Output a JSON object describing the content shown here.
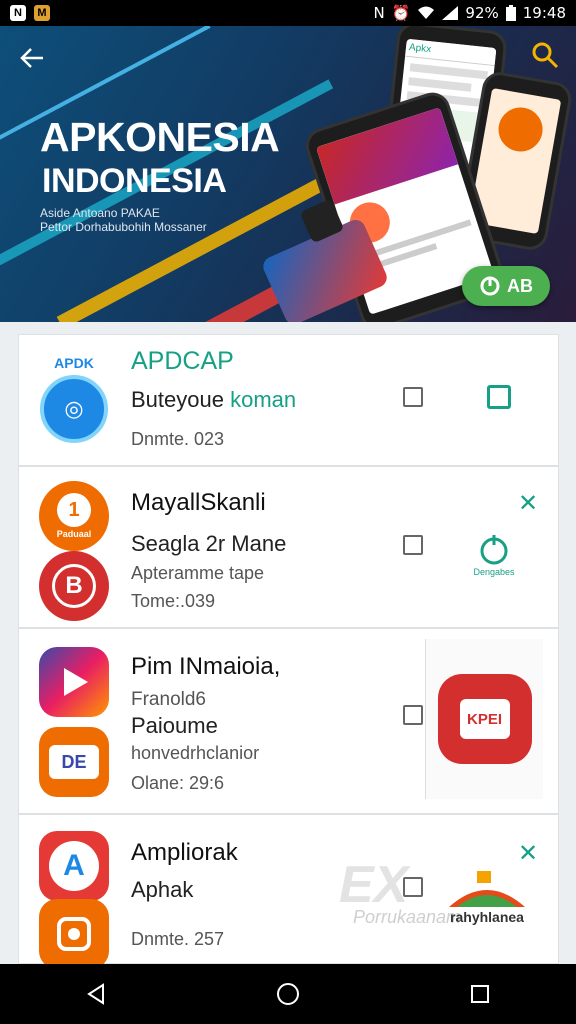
{
  "status_bar": {
    "left_icons": [
      "N",
      "M"
    ],
    "percent": "92%",
    "time": "19:48"
  },
  "banner": {
    "title": "APKONESIA",
    "subtitle": "INDONESIA",
    "tagline_1": "Aside Antoano PAKAE",
    "tagline_2": "Pettor Dorhabubohih Mossaner",
    "cta_label": "AB",
    "phone_screen_header": "Apkx"
  },
  "apps": [
    {
      "icon_top_label": "APDK",
      "icon_top_color": "#1e88e5",
      "title": "APDCAP",
      "subtitle": "Buteyoue",
      "subtitle_accent": "koman",
      "date": "Dnmte. 023"
    },
    {
      "icon_top_label": "1",
      "icon_top_caption": "Paduaal",
      "icon_top_color": "#ef6c00",
      "icon_bottom_label": "B",
      "icon_bottom_color": "#d32f2f",
      "title": "MayallSkanli",
      "subtitle": "Seagla 2r Mane",
      "line3": "Apteramme tape",
      "date": "Tome:.039",
      "side_caption": "Dengabes"
    },
    {
      "icon_top_color": "#3949ab",
      "icon_bottom_label": "DE",
      "icon_bottom_color": "#ef6c00",
      "title": "Pim INmaioia,",
      "line2": "Franold6",
      "subtitle": "Paioume",
      "line4": "honvedrhclanior",
      "date": "Olane: 29:6",
      "side_label": "KPEI",
      "side_color": "#d32f2f"
    },
    {
      "icon_top_label": "A",
      "icon_top_color": "#e53935",
      "icon_bottom_color": "#ef6c00",
      "title": "Ampliorak",
      "subtitle": "Aphak",
      "date": "Dnmte. 257",
      "side_caption": "rahyhlanea",
      "watermark": "Porrukaanam"
    }
  ],
  "colors": {
    "accent": "#16a085",
    "cta": "#4caf50",
    "banner_bg": "#123b63"
  }
}
